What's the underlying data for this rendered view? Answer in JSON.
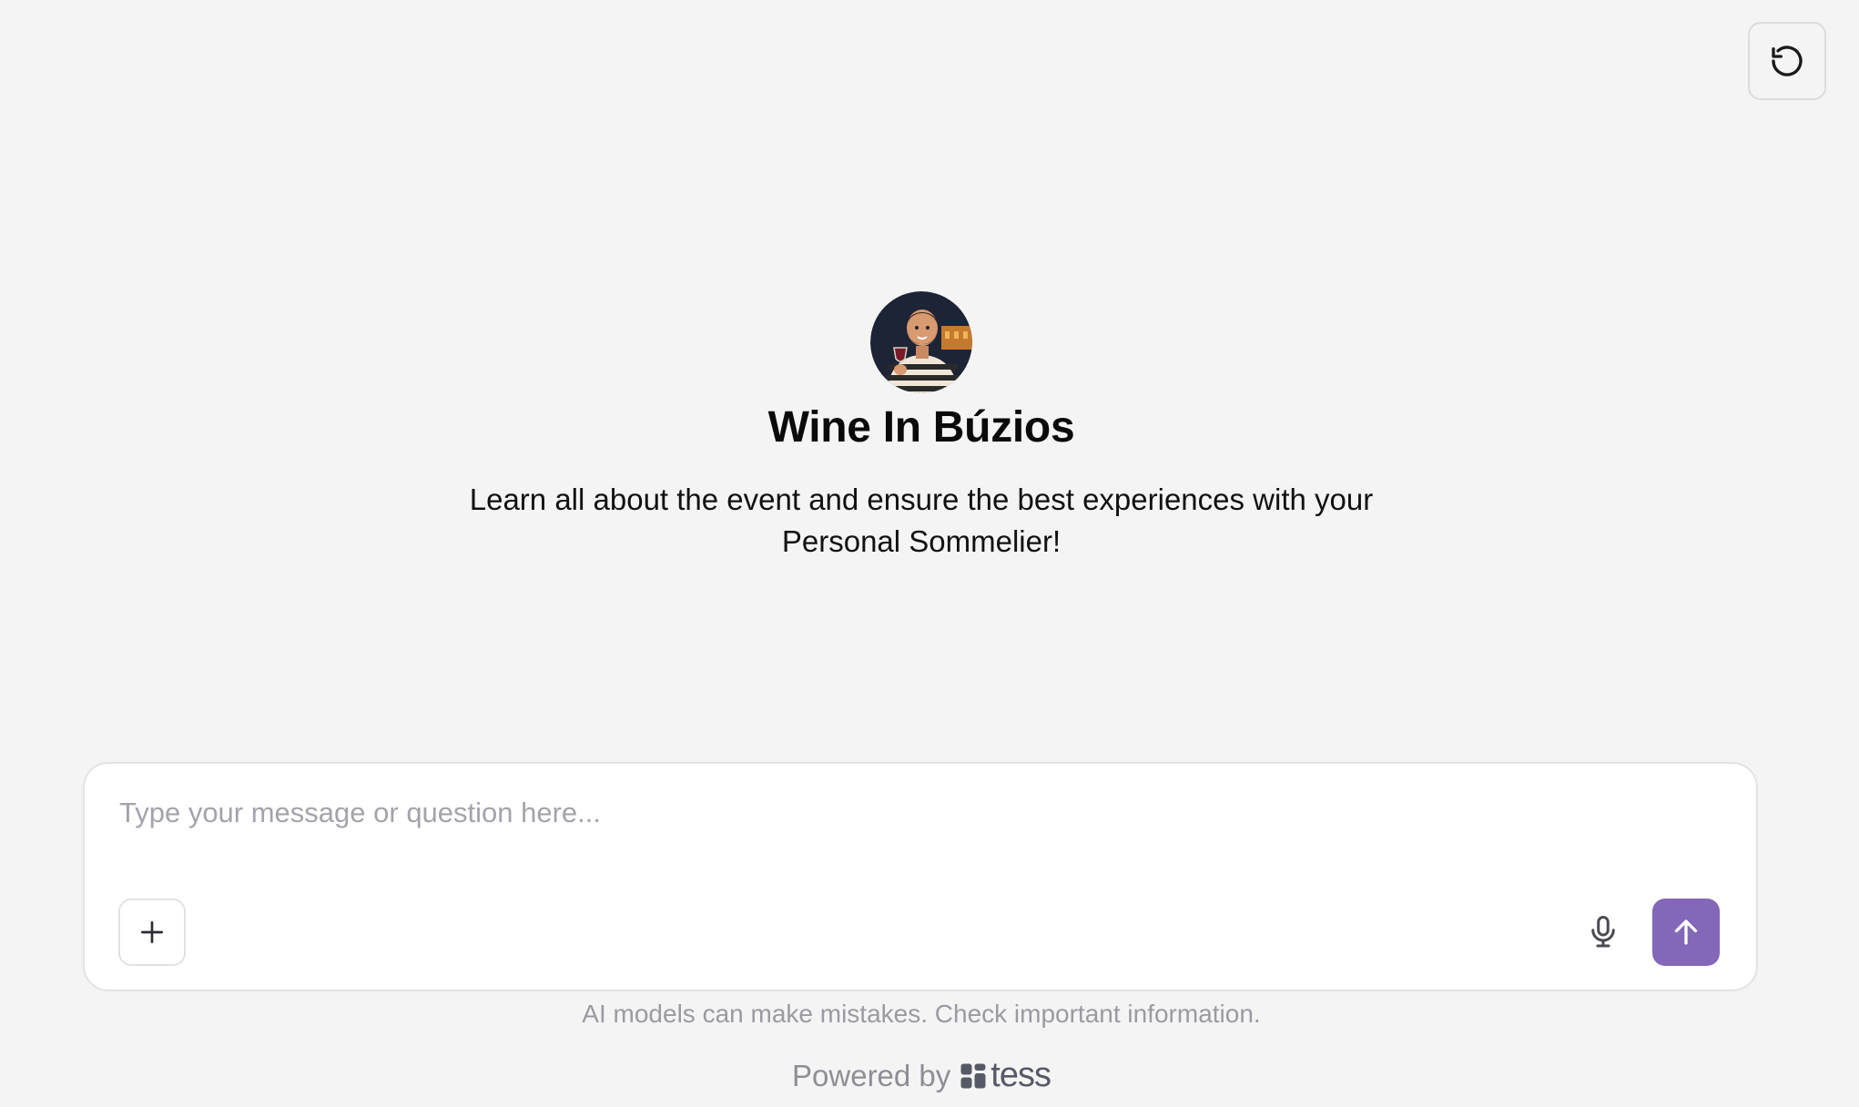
{
  "header": {
    "reset_icon": "refresh-icon"
  },
  "hero": {
    "avatar_icon": "sommelier-avatar",
    "title": "Wine In Búzios",
    "subtitle": "Learn all about the event and ensure the best experiences with your Personal Sommelier!"
  },
  "composer": {
    "placeholder": "Type your message or question here...",
    "value": "",
    "attach_icon": "plus-icon",
    "mic_icon": "microphone-icon",
    "send_icon": "arrow-up-icon",
    "send_color": "#8367b8"
  },
  "footer": {
    "disclaimer": "AI models can make mistakes. Check important information.",
    "powered_by": "Powered by",
    "brand": "tess"
  }
}
